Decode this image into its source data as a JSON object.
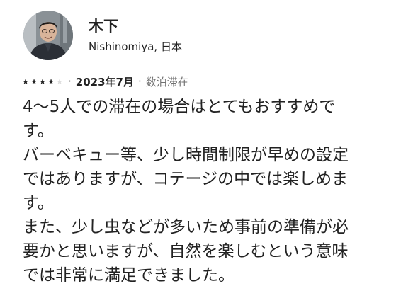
{
  "reviewer": {
    "name": "木下",
    "location": "Nishinomiya, 日本",
    "avatar_icon": "profile-photo"
  },
  "rating": {
    "stars": 4,
    "max": 5
  },
  "meta": {
    "separator": "·",
    "date": "2023年7月",
    "stay": "数泊滞在"
  },
  "review": {
    "text": "4〜5人での滞在の場合はとてもおすすめで\nす。\nバーベキュー等、少し時間制限が早めの設定\nではありますが、コテージの中では楽しめま\nす。\nまた、少し虫などが多いため事前の準備が必\n要かと思いますが、自然を楽しむという意味\nでは非常に満足できました。"
  },
  "colors": {
    "text": "#222222",
    "muted": "#717171",
    "star_filled": "#222222",
    "star_empty": "#dddddd"
  }
}
